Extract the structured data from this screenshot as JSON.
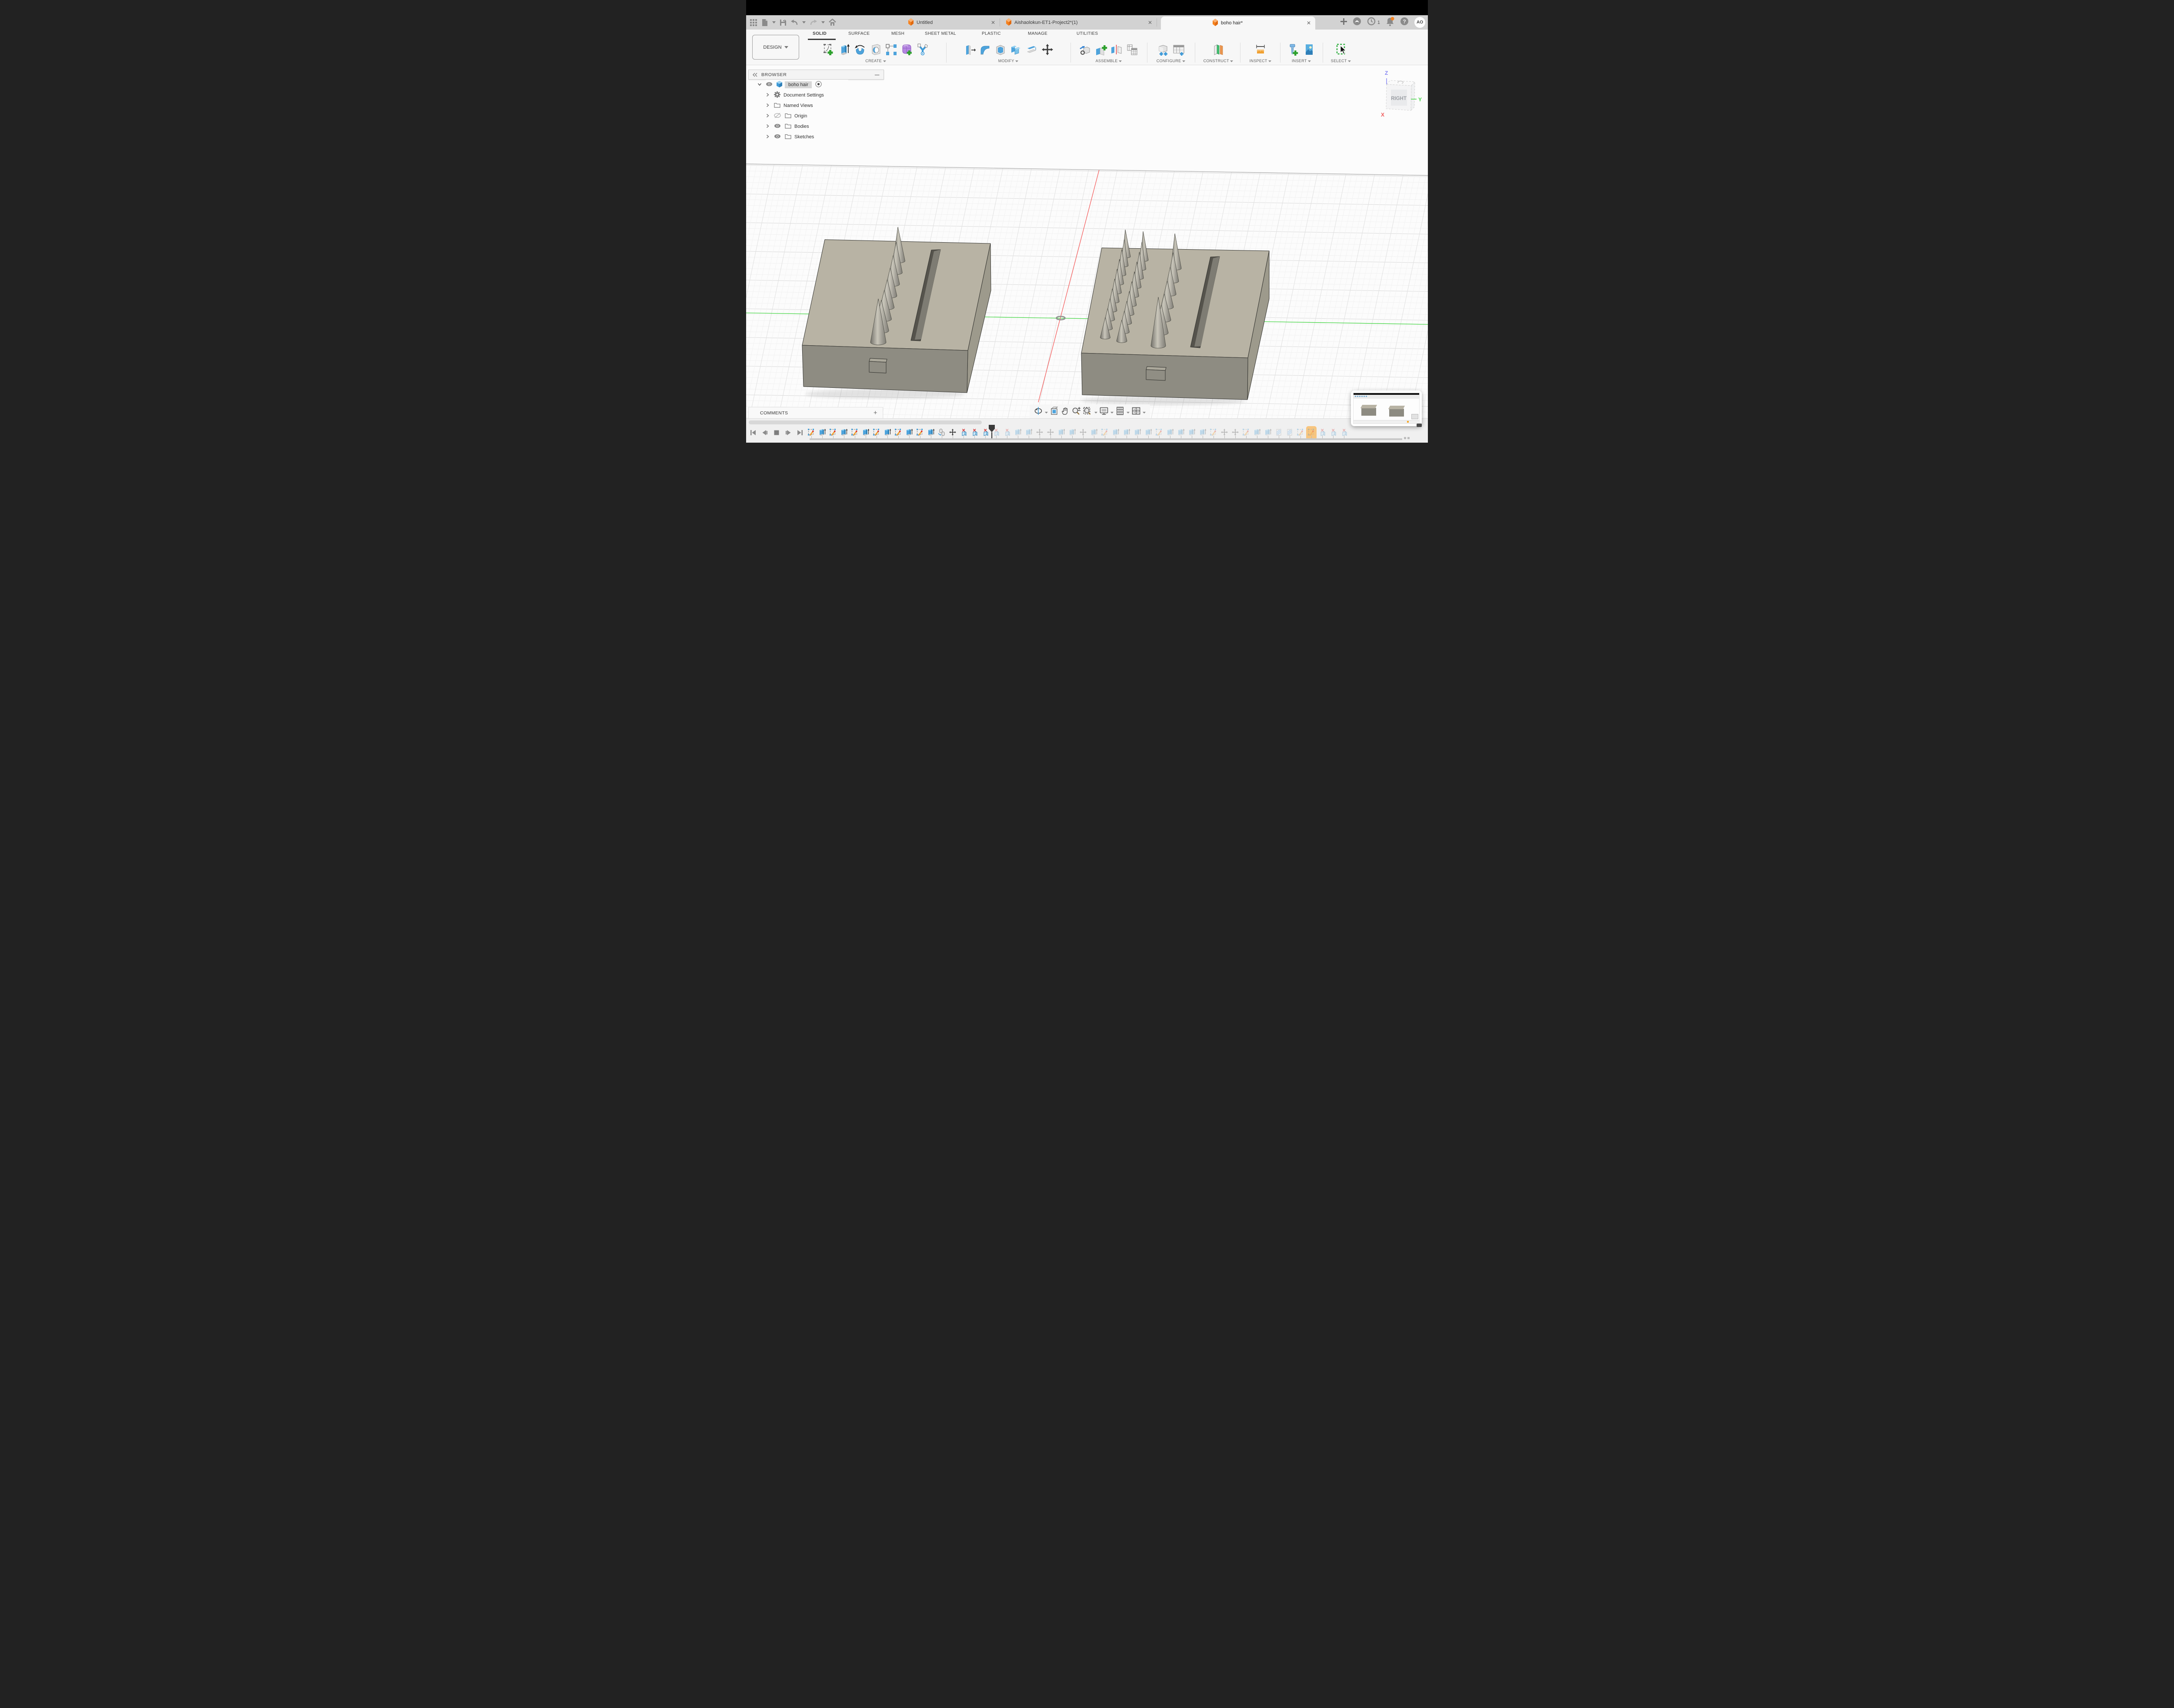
{
  "header": {
    "left_icons": [
      "app-grid",
      "file",
      "save",
      "undo",
      "redo",
      "home"
    ],
    "tabs": [
      {
        "label": "Untitled",
        "active": false
      },
      {
        "label": "Aishaolokun-ET1-Project2*(1)",
        "active": false
      },
      {
        "label": "boho hair*",
        "active": true
      }
    ],
    "right_icons": [
      "new-tab-plus",
      "extensions",
      "job-status-clock",
      "notifications-bell",
      "help"
    ],
    "job_status_count": "1",
    "avatar_initials": "AO"
  },
  "ribbon": {
    "workspace_label": "DESIGN",
    "tabs": [
      "SOLID",
      "SURFACE",
      "MESH",
      "SHEET METAL",
      "PLASTIC",
      "MANAGE",
      "UTILITIES"
    ],
    "active_tab": "SOLID",
    "groups": [
      {
        "label": "CREATE",
        "icons": [
          "create-sketch",
          "extrude",
          "revolve",
          "hole",
          "pattern",
          "form",
          "generative-study"
        ]
      },
      {
        "label": "MODIFY",
        "icons": [
          "press-pull",
          "fillet",
          "shell",
          "combine",
          "offset-face",
          "move-copy"
        ]
      },
      {
        "label": "ASSEMBLE",
        "icons": [
          "new-component",
          "joint",
          "as-built-joint",
          "tolerance-analysis"
        ]
      },
      {
        "label": "CONFIGURE",
        "icons": [
          "configuration",
          "configuration-table"
        ]
      },
      {
        "label": "CONSTRUCT",
        "icons": [
          "construction-plane"
        ]
      },
      {
        "label": "INSPECT",
        "icons": [
          "measure"
        ]
      },
      {
        "label": "INSERT",
        "icons": [
          "insert-fastener",
          "canvas"
        ]
      },
      {
        "label": "SELECT",
        "icons": [
          "select-window"
        ]
      }
    ]
  },
  "browser": {
    "title": "BROWSER",
    "document": {
      "label": "boho hair",
      "selected": true
    },
    "rows": [
      {
        "icon": "gear",
        "label": "Document Settings",
        "eye": "none"
      },
      {
        "icon": "folder",
        "label": "Named Views",
        "eye": "none"
      },
      {
        "icon": "folder",
        "label": "Origin",
        "eye": "off"
      },
      {
        "icon": "folder",
        "label": "Bodies",
        "eye": "on"
      },
      {
        "icon": "folder",
        "label": "Sketches",
        "eye": "on"
      }
    ]
  },
  "viewcube": {
    "face_label": "RIGHT",
    "axis_x": "X",
    "axis_y": "Y",
    "axis_z": "Z"
  },
  "comments": {
    "label": "COMMENTS",
    "add_icon": "plus"
  },
  "navbar": {
    "icons": [
      "orbit",
      "look-at",
      "pan",
      "zoom",
      "zoom-window",
      "display-settings",
      "grid-settings",
      "viewports"
    ]
  },
  "timeline": {
    "playback_icons": [
      "go-to-start",
      "step-back",
      "stop",
      "step-forward",
      "go-to-end"
    ],
    "features": [
      "S",
      "E",
      "S",
      "E",
      "S",
      "E",
      "S",
      "E",
      "S",
      "E",
      "S",
      "E",
      "C",
      "M",
      "X",
      "X",
      "X",
      "|",
      "x",
      "x",
      "e",
      "e",
      "m",
      "m",
      "e",
      "e",
      "m",
      "e",
      "s",
      "e",
      "e",
      "e",
      "e",
      "s",
      "e",
      "e",
      "e",
      "e",
      "s",
      "m",
      "m",
      "s",
      "e",
      "e",
      "h",
      "h",
      "s",
      "s!",
      "x",
      "x",
      "x"
    ],
    "legend": {
      "S": "sketch",
      "E": "extrude",
      "C": "copy-body",
      "M": "move",
      "X": "delete",
      "H": "section",
      "lowercase": "dimmed (after playhead)",
      "!": "highlighted",
      "|": "playhead"
    }
  },
  "colors": {
    "accent_orange": "#f5821f",
    "tool_blue": "#4da3dc",
    "tab_bar": "#d2d2d2",
    "ribbon_bg": "#f7f7f7",
    "viewport_bg": "#fcfcfc",
    "block_top": "#b8b3a4",
    "block_front": "#8e8c82",
    "block_side": "#9d9a8c",
    "axis_red": "#f05a5a",
    "axis_green": "#44d544",
    "axis_blue": "#8585f2",
    "highlight": "#f7c57f"
  }
}
